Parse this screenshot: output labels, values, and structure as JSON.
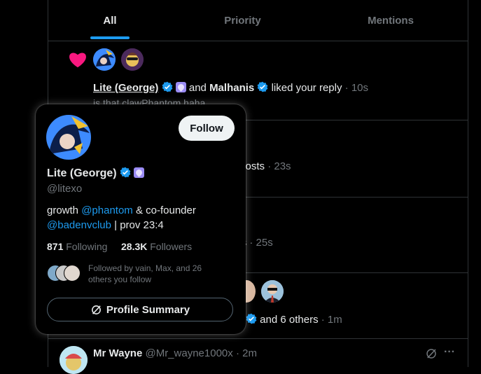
{
  "tabs": [
    {
      "label": "All",
      "active": true
    },
    {
      "label": "Priority",
      "active": false
    },
    {
      "label": "Mentions",
      "active": false
    }
  ],
  "notif1": {
    "user1": "Lite (George)",
    "conj": "and",
    "user2": "Malhanis",
    "action": "liked your reply",
    "time": "· 10s",
    "snippet": "is that clawPhantom haha"
  },
  "notif2": {
    "action": "r posts",
    "time": "· 23s"
  },
  "notif3": {
    "action": "sts",
    "time": "· 25s"
  },
  "notif4": {
    "action": "and 6 others",
    "time": "· 1m"
  },
  "notif5": {
    "name": "Mr Wayne",
    "handle": "@Mr_wayne1000x",
    "time": "· 2m",
    "more": "···"
  },
  "card": {
    "name": "Lite (George)",
    "handle": "@litexo",
    "follow": "Follow",
    "bio_pre": "growth ",
    "bio_mention1": "@phantom",
    "bio_mid": " & co-founder",
    "bio_mention2": "@badenvclub",
    "bio_post": " | prov 23:4",
    "following_count": "871",
    "following_label": "Following",
    "followers_count": "28.3K",
    "followers_label": "Followers",
    "followed_by_line1": "Followed by vain, Max, and 26",
    "followed_by_line2": "others you follow",
    "summary": "Profile Summary"
  },
  "colors": {
    "accent": "#1d9bf0",
    "like": "#f91880",
    "bg": "#000000",
    "border": "#2f3336"
  }
}
